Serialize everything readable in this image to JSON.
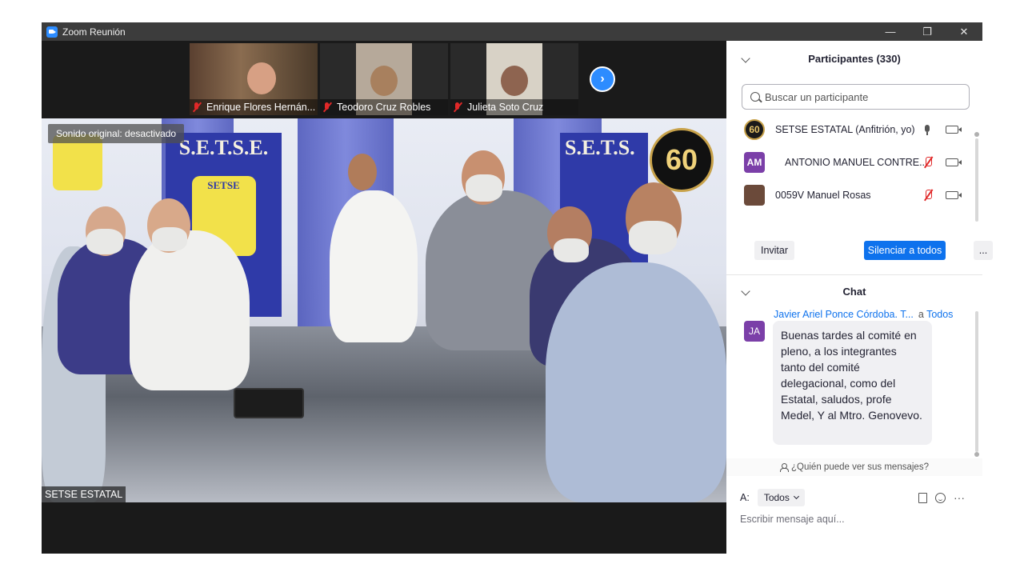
{
  "window": {
    "title": "Zoom Reunión",
    "minimize": "—",
    "maximize": "❐",
    "close": "✕"
  },
  "thumbnails": [
    {
      "name": "Enrique Flores Hernán...",
      "bg": "#8a6c50"
    },
    {
      "name": "Teodoro Cruz Robles",
      "bg": "#b6a99a"
    },
    {
      "name": "Julieta Soto Cruz",
      "bg": "#d8d2c6"
    }
  ],
  "next_arrow": "›",
  "main_video": {
    "original_sound": "Sonido original: desactivado",
    "speaker_name": "SETSE ESTATAL",
    "banner_left": "S.E.T.S.E.",
    "banner_right": "S.E.T.S.",
    "banner_mid": "SETSE",
    "badge": "60"
  },
  "participants": {
    "title": "Participantes (330)",
    "search_placeholder": "Buscar un participante",
    "list": [
      {
        "initials": "60",
        "name": "SETSE ESTATAL (Anfitrión, yo)",
        "avatar_color": "#1a1a1a",
        "muted": false
      },
      {
        "initials": "AM",
        "name": "ANTONIO MANUEL CONTRE...",
        "avatar_color": "#7b3fa8",
        "muted": true
      },
      {
        "initials": "",
        "name": "0059V Manuel Rosas",
        "avatar_color": "#6b4a3a",
        "muted": true
      }
    ],
    "invite": "Invitar",
    "mute_all": "Silenciar a todos",
    "more": "..."
  },
  "chat": {
    "title": "Chat",
    "message": {
      "sender": "Javier Ariel Ponce Córdoba. T...",
      "to_prefix": "a",
      "to": "Todos",
      "initials": "JA",
      "text": "Buenas tardes al comité en pleno, a los integrantes tanto del comité delegacional, como del Estatal, saludos, profe Medel, Y al Mtro. Genovevo."
    },
    "who_sees": "¿Quién puede ver sus mensajes?",
    "to_label": "A:",
    "to_value": "Todos",
    "more": "···",
    "input_placeholder": "Escribir mensaje aquí..."
  }
}
